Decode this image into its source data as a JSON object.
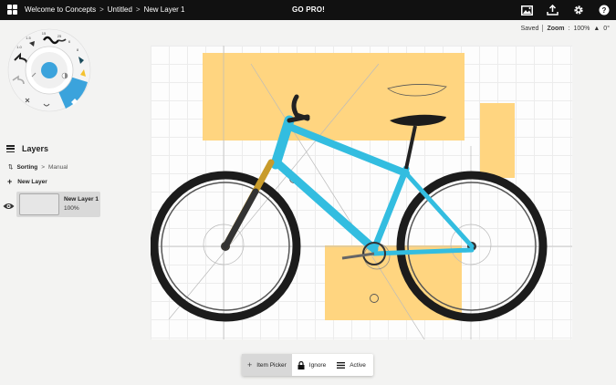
{
  "topbar": {
    "breadcrumbs": [
      "Welcome to Concepts",
      "Untitled",
      "New Layer 1"
    ],
    "separator": ">",
    "promo": "GO PRO!",
    "icons": [
      "gallery-icon",
      "upload-icon",
      "gear-icon",
      "help-icon"
    ]
  },
  "status": {
    "saved": "Saved",
    "zoom_label": "Zoom",
    "zoom_value": "100%",
    "rotation": "0°"
  },
  "tool_wheel": {
    "size_labels": [
      "1.5",
      "15",
      "25",
      "1.0",
      "6",
      "8"
    ]
  },
  "layers": {
    "title": "Layers",
    "sorting_label": "Sorting",
    "sorting_sep": ">",
    "sorting_value": "Manual",
    "new_layer": "New Layer",
    "items": [
      {
        "name": "New Layer 1",
        "opacity": "100%"
      }
    ]
  },
  "bottom_toolbar": {
    "item_picker": "Item Picker",
    "ignore": "Ignore",
    "active": "Active"
  },
  "colors": {
    "accent_blue": "#3ba3dc",
    "bike_frame": "#33bde0",
    "yellow_blocks": "#ffd580",
    "topbar": "#111111"
  }
}
